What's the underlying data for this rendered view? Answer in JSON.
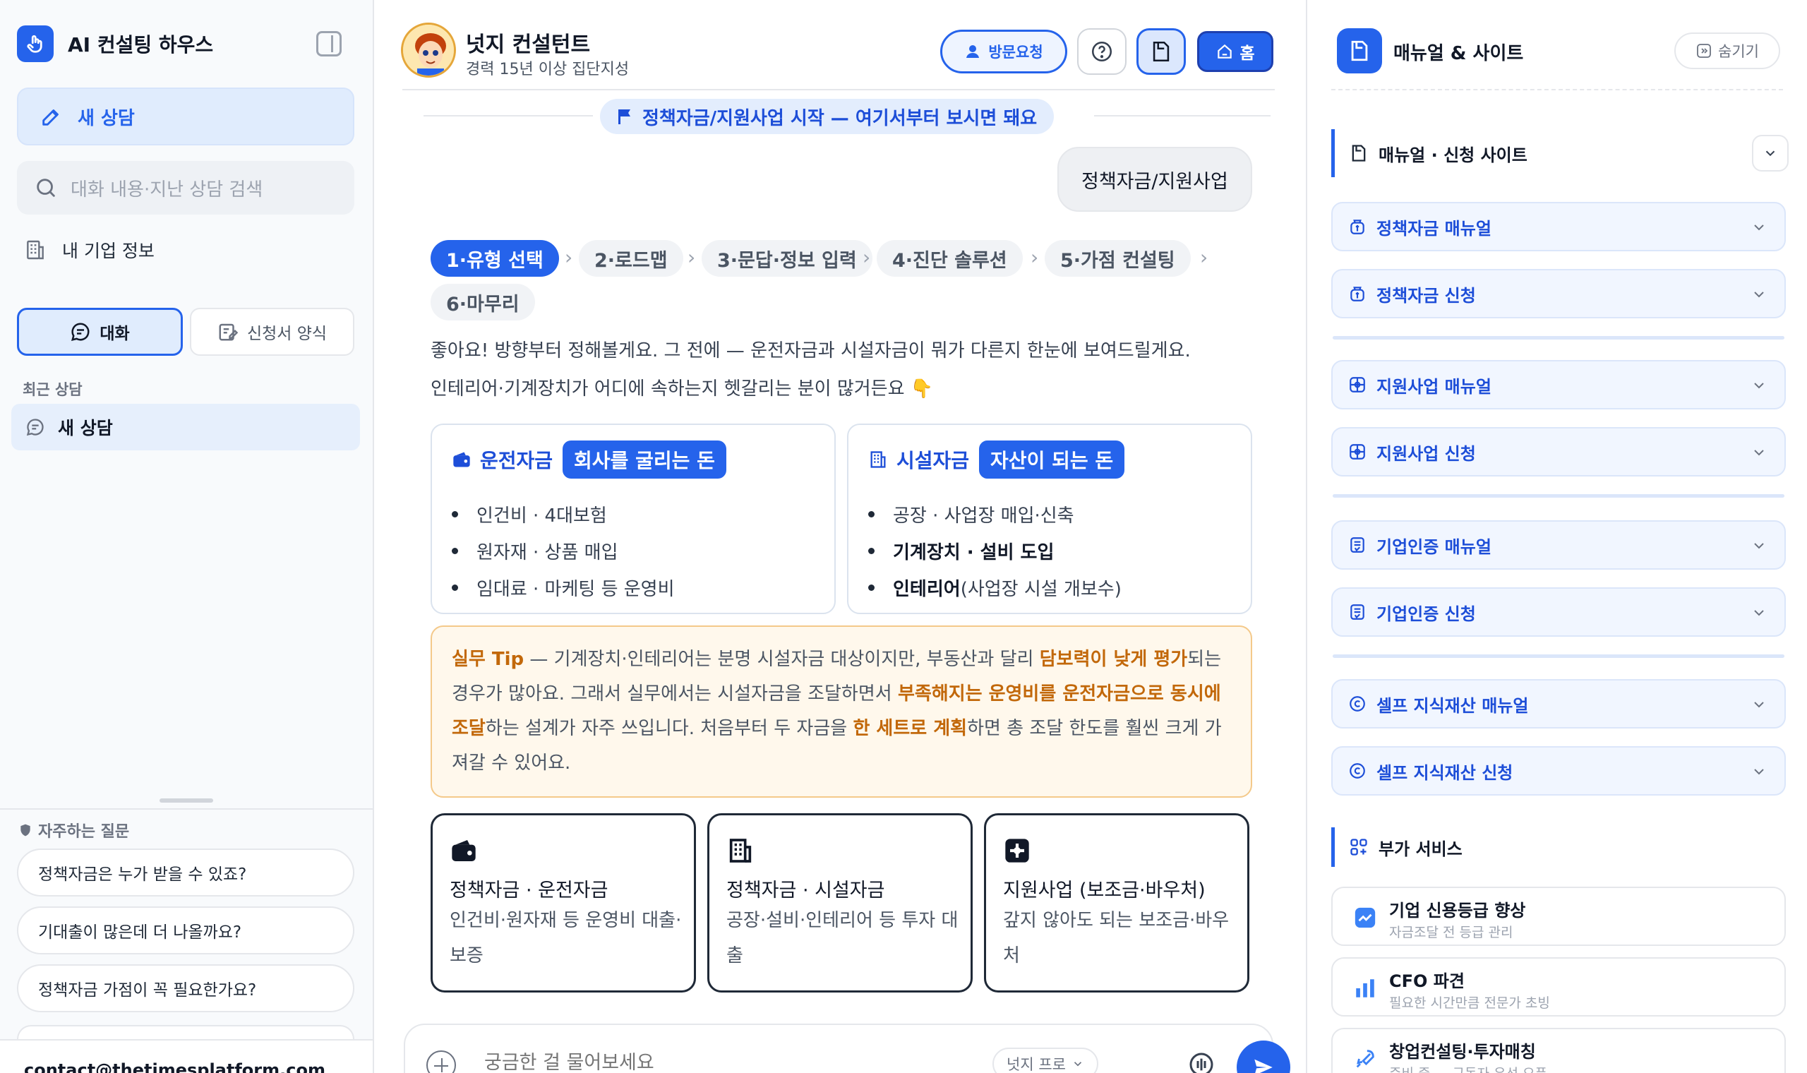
{
  "sidebar": {
    "brand_title": "AI 컨설팅 하우스",
    "new_chat": "새 상담",
    "search_placeholder": "대화 내용·지난 상담 검색",
    "company_info": "내 기업 정보",
    "tabs": [
      {
        "label": "대화",
        "active": true
      },
      {
        "label": "신청서 양식",
        "active": false
      }
    ],
    "recent_header": "최근 상담",
    "recent_items": [
      "새 상담"
    ],
    "faq_header": "자주하는 질문",
    "faq_items": [
      "정책자금은 누가 받을 수 있죠?",
      "기대출이 많은데 더 나올까요?",
      "정책자금 가점이 꼭 필요한가요?"
    ],
    "contact": "contact@thetimesplatform.com"
  },
  "header": {
    "agent_name": "넛지 컨설턴트",
    "agent_subtitle": "경력 15년 이상 집단지성",
    "visit_button": "방문요청",
    "home_button": "홈"
  },
  "chat": {
    "section_pill": "정책자금/지원사업 시작 — 여기서부터 보시면 돼요",
    "user_message": "정책자금/지원사업",
    "steps": [
      "1·유형 선택",
      "2·로드맵",
      "3·문답·정보 입력",
      "4·진단 솔루션",
      "5·가점 컨설팅",
      "6·마무리"
    ],
    "active_step": 0,
    "intro_line1": "좋아요! 방향부터 정해볼게요. 그 전에 — 운전자금과 시설자금이 뭐가 다른지 한눈에 보여드릴게요.",
    "intro_line2": "인테리어·기계장치가 어디에 속하는지 헷갈리는 분이 많거든요 👇",
    "fund_cards": [
      {
        "title": "운전자금",
        "tag": "회사를 굴리는 돈",
        "items": [
          {
            "text": "인건비 · 4대보험",
            "bold": "",
            "rest": ""
          },
          {
            "text": "원자재 · 상품 매입",
            "bold": "",
            "rest": ""
          },
          {
            "text": "임대료 · 마케팅 등 운영비",
            "bold": "",
            "rest": ""
          }
        ]
      },
      {
        "title": "시설자금",
        "tag": "자산이 되는 돈",
        "items": [
          {
            "text": "공장 · 사업장 매입·신축",
            "bold": "",
            "rest": ""
          },
          {
            "text": "",
            "bold": "기계장치 · 설비 도입",
            "rest": ""
          },
          {
            "text": "",
            "bold": "인테리어",
            "rest": "(사업장 시설 개보수)"
          }
        ]
      }
    ],
    "tip": {
      "label": "실무 Tip",
      "p1": " — 기계장치·인테리어는 분명 시설자금 대상이지만, 부동산과 달리 ",
      "h1": "담보력이 낮게 평가",
      "p2": "되는 경우가 많아요. 그래서 실무에서는 시설자금을 조달하면서 ",
      "h2": "부족해지는 운영비를 운전자금으로 동시에 조달",
      "p3": "하는 설계가 자주 쓰입니다. 처음부터 두 자금을 ",
      "h3": "한 세트로 계획",
      "p4": "하면 총 조달 한도를 훨씬 크게 가져갈 수 있어요."
    },
    "options": [
      {
        "title": "정책자금 · 운전자금",
        "desc": "인건비·원자재 등 운영비 대출·보증",
        "icon": "wallet-icon"
      },
      {
        "title": "정책자금 · 시설자금",
        "desc": "공장·설비·인테리어 등 투자 대출",
        "icon": "building-icon"
      },
      {
        "title": "지원사업 (보조금·바우처)",
        "desc": "갚지 않아도 되는 보조금·바우처",
        "icon": "grant-icon"
      }
    ],
    "composer_placeholder": "궁금한 걸 물어보세요",
    "model_label": "넛지 프로"
  },
  "right_panel": {
    "title": "매뉴얼 & 사이트",
    "hide_button": "숨기기",
    "section_manuals": "매뉴얼 · 신청 사이트",
    "accordions": [
      {
        "label": "정책자금 매뉴얼",
        "icon": "money-bag-icon"
      },
      {
        "label": "정책자금 신청",
        "icon": "money-bag-icon"
      },
      {
        "label": "지원사업 매뉴얼",
        "icon": "gift-icon"
      },
      {
        "label": "지원사업 신청",
        "icon": "gift-icon"
      },
      {
        "label": "기업인증 매뉴얼",
        "icon": "certificate-icon"
      },
      {
        "label": "기업인증 신청",
        "icon": "certificate-icon"
      },
      {
        "label": "셀프 지식재산 매뉴얼",
        "icon": "copyright-icon"
      },
      {
        "label": "셀프 지식재산 신청",
        "icon": "copyright-icon"
      }
    ],
    "section_services": "부가 서비스",
    "services": [
      {
        "title": "기업 신용등급 향상",
        "sub": "자금조달 전 등급 관리",
        "icon": "trend-icon"
      },
      {
        "title": "CFO 파견",
        "sub": "필요한 시간만큼 전문가 초빙",
        "icon": "bar-chart-icon"
      },
      {
        "title": "창업컨설팅·투자매칭",
        "sub": "준비 중 — 구독자 우선 오픈",
        "icon": "rocket-icon"
      }
    ]
  },
  "colors": {
    "accent": "#2563eb",
    "accent_light": "#e0ecfd",
    "tip_highlight": "#c2680a",
    "tip_bg": "#fff8ec"
  }
}
